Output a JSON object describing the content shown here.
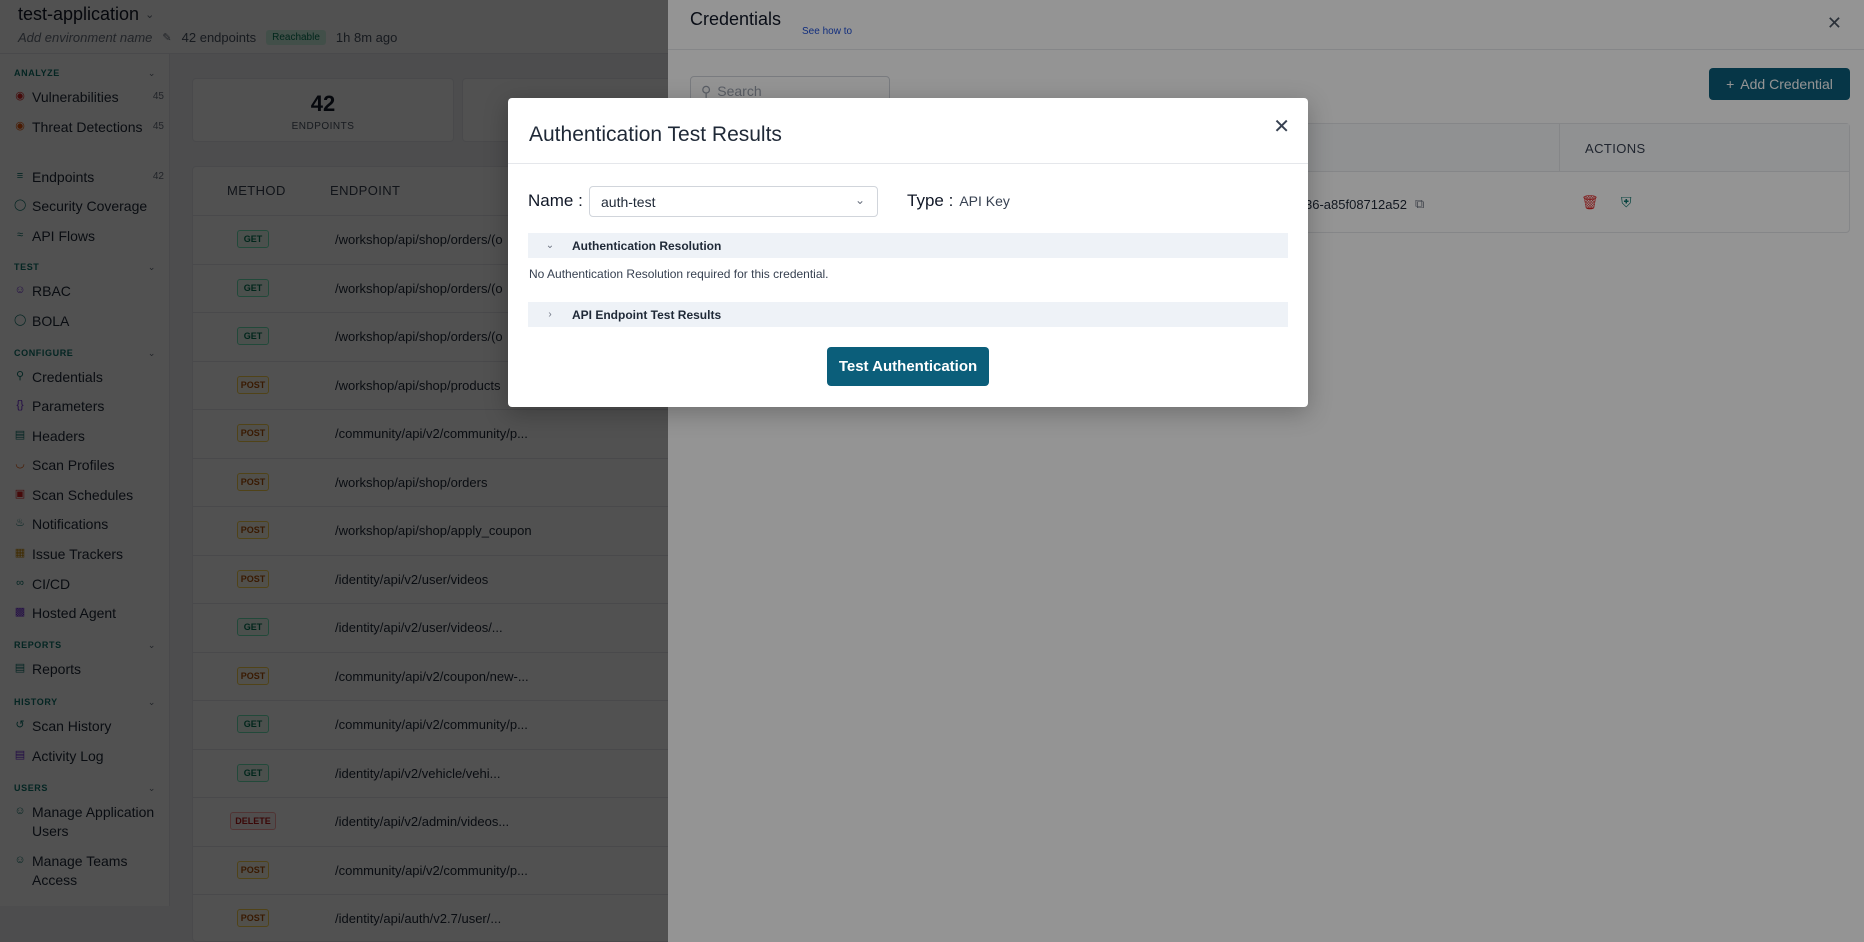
{
  "app": {
    "title": "test-application",
    "env_placeholder": "Add environment name",
    "endpoints_count": "42 endpoints",
    "status": "Reachable",
    "last_seen": "1h 8m ago"
  },
  "sidebar": {
    "sections": {
      "analyze": "ANALYZE",
      "test": "TEST",
      "configure": "CONFIGURE",
      "reports": "REPORTS",
      "history": "HISTORY",
      "users": "USERS"
    },
    "items": [
      {
        "label": "Vulnerabilities",
        "count": "45"
      },
      {
        "label": "Threat Detections",
        "count": "45"
      },
      {
        "label": "Endpoints",
        "count": "42"
      },
      {
        "label": "Security Coverage"
      },
      {
        "label": "API Flows"
      },
      {
        "label": "RBAC"
      },
      {
        "label": "BOLA"
      },
      {
        "label": "Credentials"
      },
      {
        "label": "Parameters"
      },
      {
        "label": "Headers"
      },
      {
        "label": "Scan Profiles"
      },
      {
        "label": "Scan Schedules"
      },
      {
        "label": "Notifications"
      },
      {
        "label": "Issue Trackers"
      },
      {
        "label": "CI/CD"
      },
      {
        "label": "Hosted Agent"
      },
      {
        "label": "Reports"
      },
      {
        "label": "Scan History"
      },
      {
        "label": "Activity Log"
      },
      {
        "label": "Manage Application Users"
      },
      {
        "label": "Manage Teams Access"
      }
    ]
  },
  "stats": {
    "endpoints_value": "42",
    "endpoints_label": "ENDPOINTS"
  },
  "endpoints_table": {
    "headers": {
      "method": "METHOD",
      "endpoint": "ENDPOINT"
    },
    "rows": [
      {
        "method": "GET",
        "path": "/workshop/api/shop/orders/(o"
      },
      {
        "method": "GET",
        "path": "/workshop/api/shop/orders/(o"
      },
      {
        "method": "GET",
        "path": "/workshop/api/shop/orders/(o"
      },
      {
        "method": "POST",
        "path": "/workshop/api/shop/products"
      },
      {
        "method": "POST",
        "path": "/community/api/v2/community/p..."
      },
      {
        "method": "POST",
        "path": "/workshop/api/shop/orders"
      },
      {
        "method": "POST",
        "path": "/workshop/api/shop/apply_coupon"
      },
      {
        "method": "POST",
        "path": "/identity/api/v2/user/videos"
      },
      {
        "method": "GET",
        "path": "/identity/api/v2/user/videos/..."
      },
      {
        "method": "POST",
        "path": "/community/api/v2/coupon/new-..."
      },
      {
        "method": "GET",
        "path": "/community/api/v2/community/p..."
      },
      {
        "method": "GET",
        "path": "/identity/api/v2/vehicle/vehi..."
      },
      {
        "method": "DELETE",
        "path": "/identity/api/v2/admin/videos..."
      },
      {
        "method": "POST",
        "path": "/community/api/v2/community/p..."
      },
      {
        "method": "POST",
        "path": "/identity/api/auth/v2.7/user/..."
      }
    ]
  },
  "drawer": {
    "title": "Credentials",
    "see_how": "See how to",
    "search_placeholder": "Search",
    "add_button": "Add Credential",
    "actions_header": "ACTIONS",
    "credential_id_fragment": "36-a85f08712a52"
  },
  "modal": {
    "title": "Authentication Test Results",
    "name_label": "Name :",
    "name_value": "auth-test",
    "type_label": "Type :",
    "type_value": "API Key",
    "section1_title": "Authentication Resolution",
    "section1_body": "No Authentication Resolution required for this credential.",
    "section2_title": "API Endpoint Test Results",
    "test_button": "Test Authentication"
  },
  "colors": {
    "primary": "#0b5e7a",
    "section_label": "#0f766e",
    "accordion_bg": "#eef2f7"
  }
}
